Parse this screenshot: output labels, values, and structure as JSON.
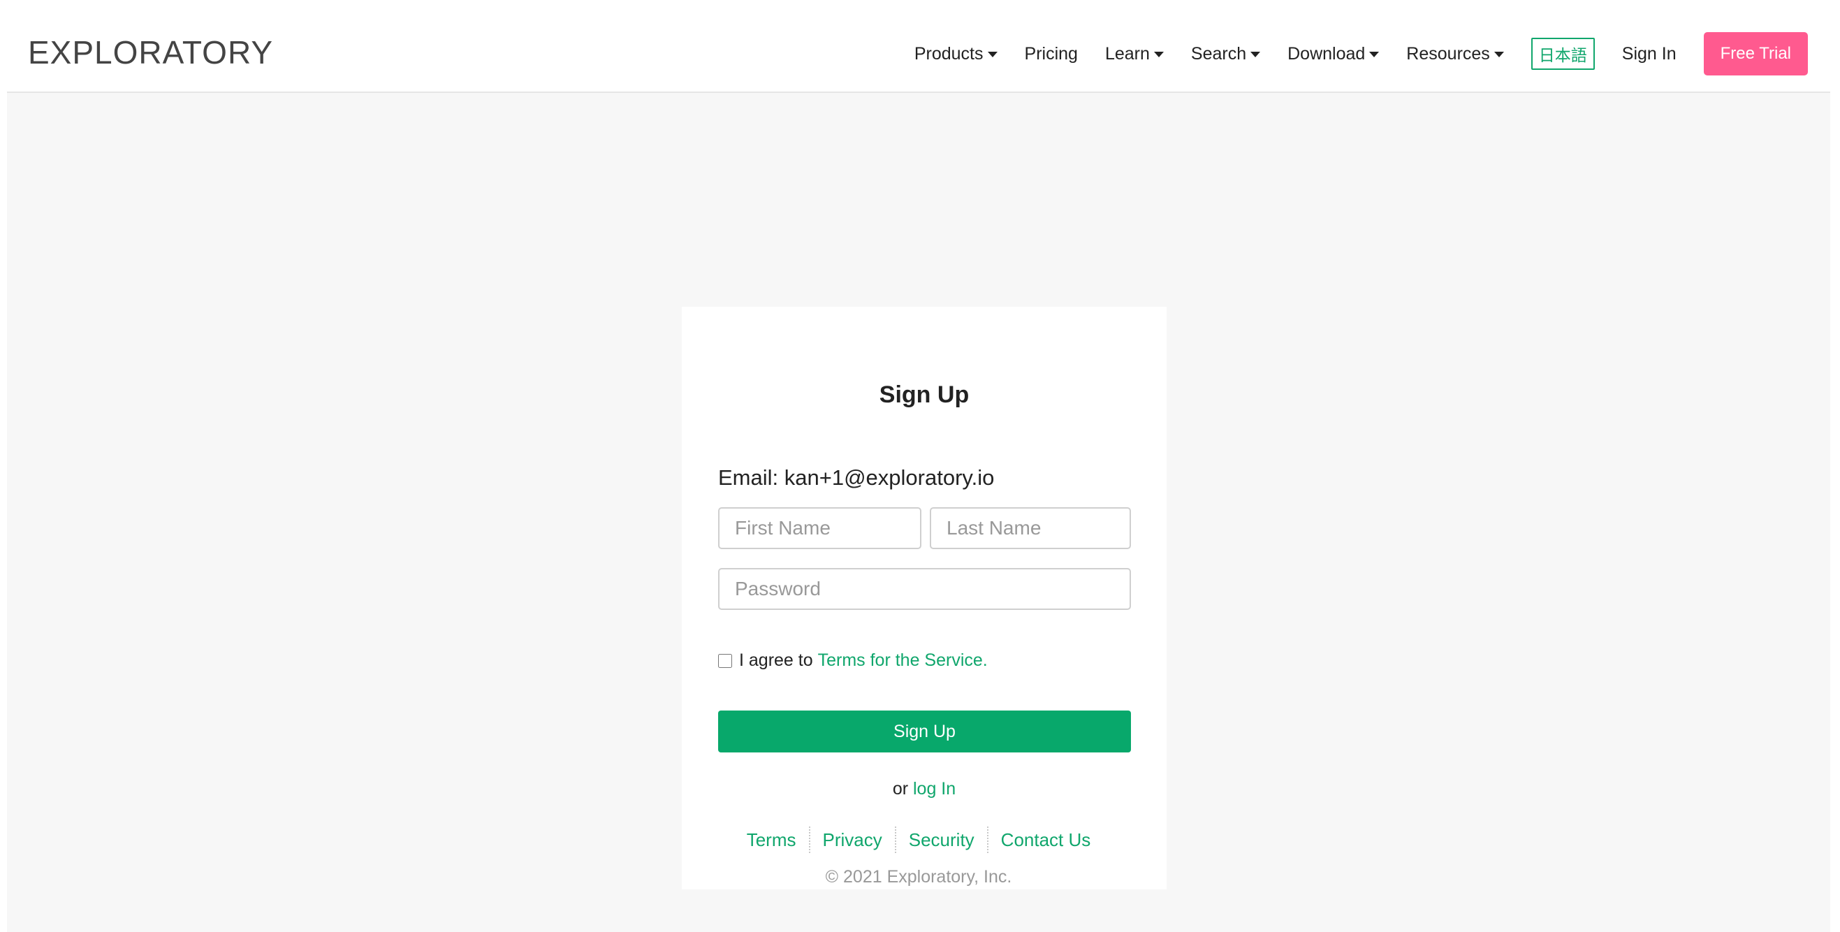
{
  "header": {
    "logo": "EXPLORATORY",
    "nav": {
      "products": "Products",
      "pricing": "Pricing",
      "learn": "Learn",
      "search": "Search",
      "download": "Download",
      "resources": "Resources",
      "language": "日本語",
      "sign_in": "Sign In",
      "free_trial": "Free Trial"
    }
  },
  "signup": {
    "title": "Sign Up",
    "email_line": "Email: kan+1@exploratory.io",
    "first_name_placeholder": "First Name",
    "last_name_placeholder": "Last Name",
    "password_placeholder": "Password",
    "agree_text": "I agree to",
    "terms_link": "Terms for the Service.",
    "submit_label": "Sign Up",
    "or_text": "or",
    "login_link": "log In"
  },
  "footer": {
    "links": [
      "Terms",
      "Privacy",
      "Security",
      "Contact Us"
    ],
    "copyright": "© 2021 Exploratory, Inc."
  },
  "colors": {
    "accent_green": "#08a86b",
    "free_trial_pink": "#ff5a8f",
    "background": "#f7f7f7"
  }
}
